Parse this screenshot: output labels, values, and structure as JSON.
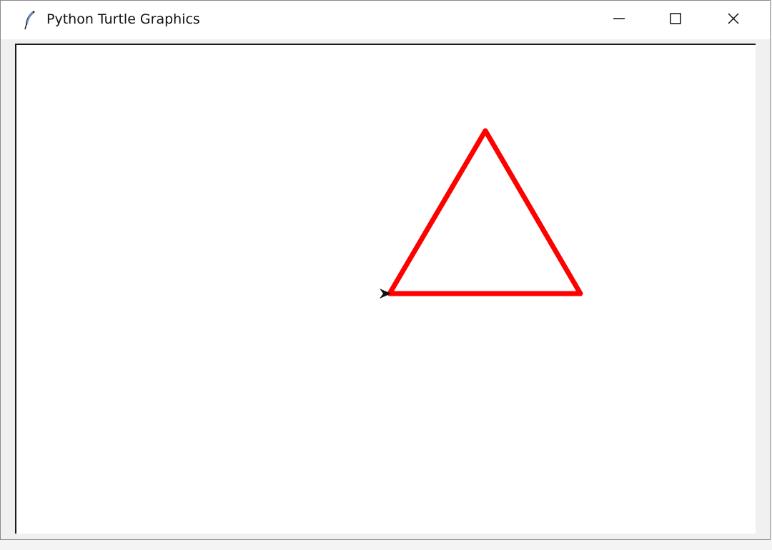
{
  "window": {
    "title": "Python Turtle Graphics",
    "icon": "feather-icon",
    "controls": {
      "minimize": "minimize-icon",
      "maximize": "maximize-icon",
      "close": "close-icon"
    }
  },
  "canvas": {
    "background": "#ffffff",
    "drawing": {
      "shape": "triangle",
      "pen_color": "#ff0000",
      "turtle_color": "#000000",
      "turtle_icon": "turtle-arrow-icon"
    }
  }
}
